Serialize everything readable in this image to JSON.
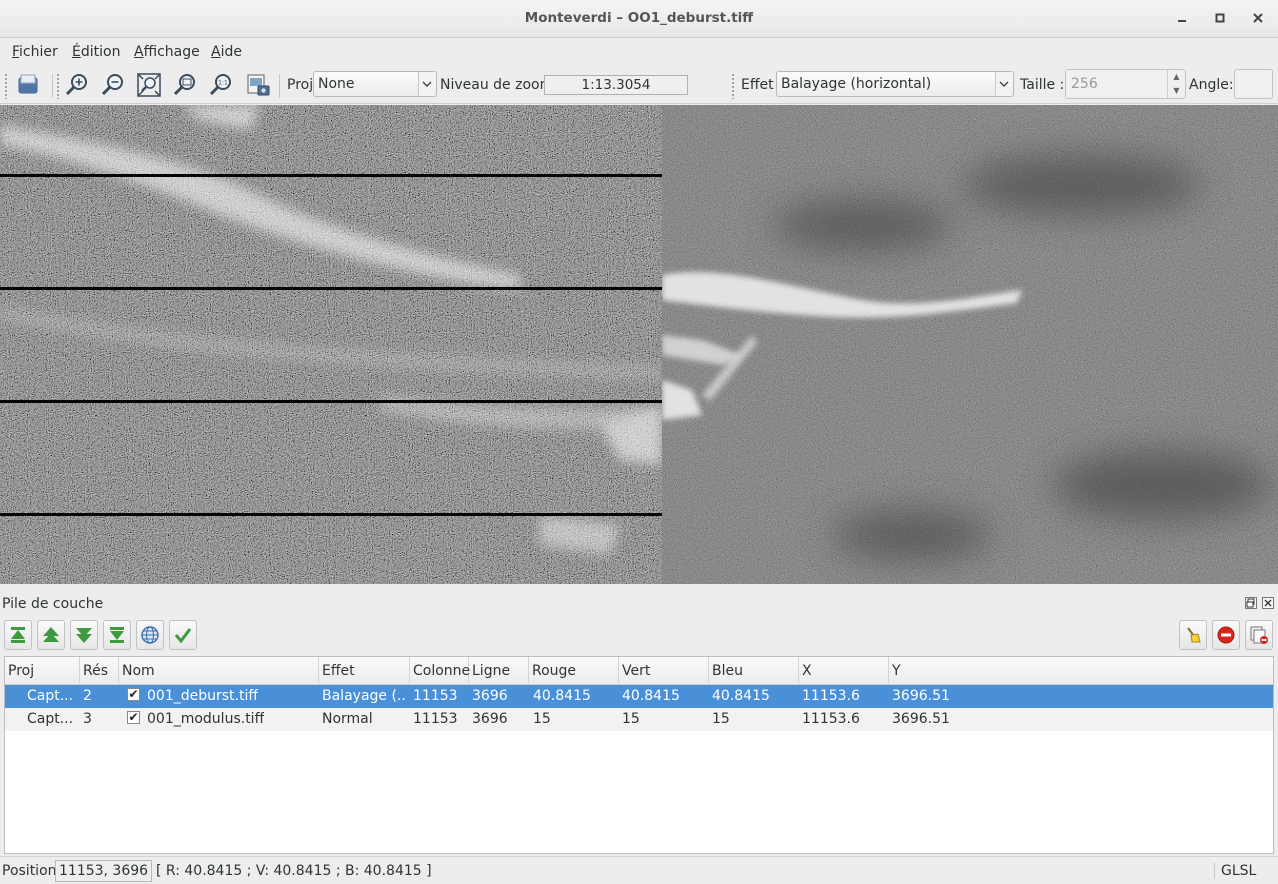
{
  "window": {
    "title": "Monteverdi – OO1_deburst.tiff"
  },
  "menu": [
    {
      "label": "Fichier",
      "key": "F",
      "rest": "ichier"
    },
    {
      "label": "Édition",
      "key": "É",
      "rest": "dition"
    },
    {
      "label": "Affichage",
      "key": "A",
      "rest": "ffichage"
    },
    {
      "label": "Aide",
      "key": "A",
      "rest": "ide"
    }
  ],
  "toolbar": {
    "proj_label": "Proj",
    "proj_value": "None",
    "zoom_label": "Niveau de zoom",
    "zoom_value": "1:13.3054",
    "effect_label": "Effet",
    "effect_value": "Balayage (horizontal)",
    "size_label": "Taille :",
    "size_value": "256",
    "angle_label": "Angle:",
    "angle_value": ""
  },
  "layer_panel": {
    "title": "Pile de couche",
    "columns": [
      "Proj",
      "Rés",
      "Nom",
      "Effet",
      "Colonne",
      "Ligne",
      "Rouge",
      "Vert",
      "Bleu",
      "X",
      "Y"
    ],
    "rows": [
      {
        "proj": "Capt...",
        "res": "2",
        "name": "001_deburst.tiff",
        "effect": "Balayage (...",
        "col": "11153",
        "line": "3696",
        "red": "40.8415",
        "green": "40.8415",
        "blue": "40.8415",
        "x": "11153.6",
        "y": "3696.51",
        "checked": true,
        "selected": true
      },
      {
        "proj": "Capt...",
        "res": "3",
        "name": "001_modulus.tiff",
        "effect": "Normal",
        "col": "11153",
        "line": "3696",
        "red": "15",
        "green": "15",
        "blue": "15",
        "x": "11153.6",
        "y": "3696.51",
        "checked": true,
        "selected": false
      }
    ]
  },
  "status": {
    "position_label": "Position",
    "position_value": "11153, 3696",
    "pixel_values": "[ R: 40.8415 ; V: 40.8415 ; B: 40.8415 ]",
    "renderer": "GLSL"
  },
  "colors": {
    "selection": "#4a90d9",
    "arrow_green": "#3f9a3f"
  }
}
